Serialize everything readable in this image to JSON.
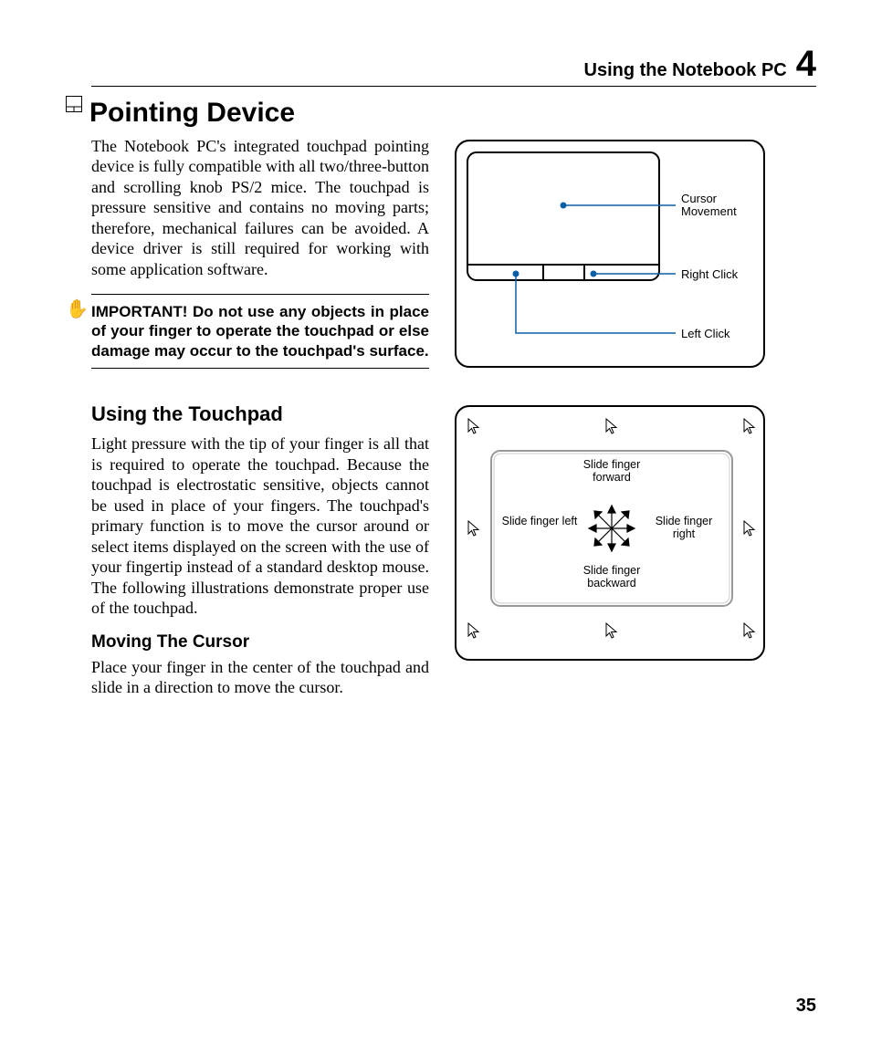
{
  "header": {
    "running_title": "Using the Notebook PC",
    "chapter_number": "4"
  },
  "h1": "Pointing Device",
  "intro_paragraph": "The Notebook PC's integrated touchpad pointing device is fully compatible with all two/three-button and scrolling knob PS/2 mice. The touchpad is pressure sensitive and contains no moving parts; therefore, mechanical failures can be avoided. A device driver is still required for working with some application software.",
  "important_note": "IMPORTANT! Do not use any objects in place of your finger to operate the touchpad or else damage may occur to the touchpad's surface.",
  "section2": {
    "heading": "Using the Touchpad",
    "paragraph": "Light pressure with the tip of your finger is all that is required to operate the touchpad. Because the touchpad is electrostatic sensitive, objects cannot be used in place of your fingers. The touchpad's primary function is to move the cursor around or select items displayed on the screen with the use of your fingertip instead of a standard desktop mouse. The following illustrations demonstrate proper use of the touchpad.",
    "sub_heading": "Moving The Cursor",
    "sub_paragraph": "Place your finger in the center of the touchpad and slide in a direction to move the cursor."
  },
  "figure1_labels": {
    "cursor_movement": "Cursor Movement",
    "right_click": "Right Click",
    "left_click": "Left Click"
  },
  "figure2_labels": {
    "forward": "Slide finger forward",
    "backward": "Slide finger backward",
    "left": "Slide finger left",
    "right": "Slide finger right"
  },
  "page_number": "35"
}
